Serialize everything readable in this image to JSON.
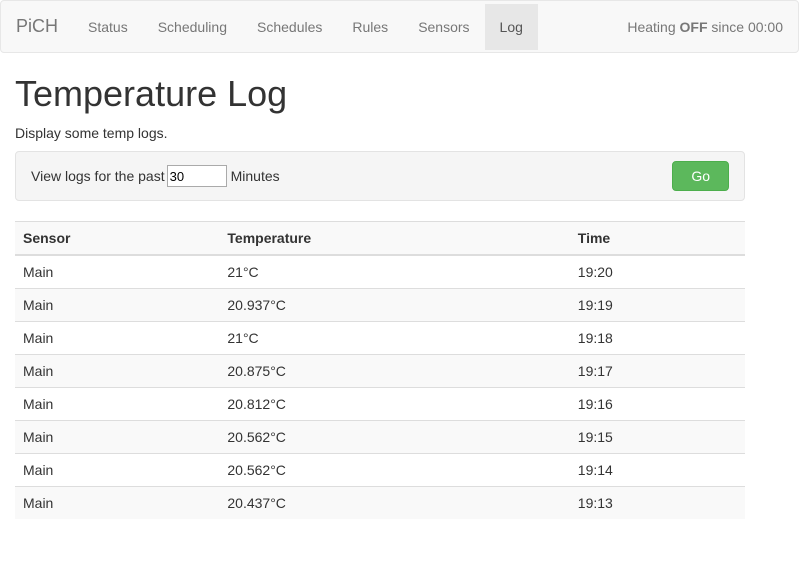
{
  "brand": "PiCH",
  "nav": {
    "items": [
      {
        "label": "Status",
        "active": false
      },
      {
        "label": "Scheduling",
        "active": false
      },
      {
        "label": "Schedules",
        "active": false
      },
      {
        "label": "Rules",
        "active": false
      },
      {
        "label": "Sensors",
        "active": false
      },
      {
        "label": "Log",
        "active": true
      }
    ]
  },
  "status": {
    "prefix": "Heating ",
    "state": "OFF",
    "suffix": " since 00:00"
  },
  "page": {
    "title": "Temperature Log",
    "subtitle": "Display some temp logs."
  },
  "filter": {
    "prefix": "View logs for the past",
    "value": "30",
    "unit": "Minutes",
    "go_label": "Go"
  },
  "table": {
    "headers": {
      "sensor": "Sensor",
      "temperature": "Temperature",
      "time": "Time"
    },
    "rows": [
      {
        "sensor": "Main",
        "temperature": "21°C",
        "time": "19:20"
      },
      {
        "sensor": "Main",
        "temperature": "20.937°C",
        "time": "19:19"
      },
      {
        "sensor": "Main",
        "temperature": "21°C",
        "time": "19:18"
      },
      {
        "sensor": "Main",
        "temperature": "20.875°C",
        "time": "19:17"
      },
      {
        "sensor": "Main",
        "temperature": "20.812°C",
        "time": "19:16"
      },
      {
        "sensor": "Main",
        "temperature": "20.562°C",
        "time": "19:15"
      },
      {
        "sensor": "Main",
        "temperature": "20.562°C",
        "time": "19:14"
      },
      {
        "sensor": "Main",
        "temperature": "20.437°C",
        "time": "19:13"
      }
    ]
  }
}
